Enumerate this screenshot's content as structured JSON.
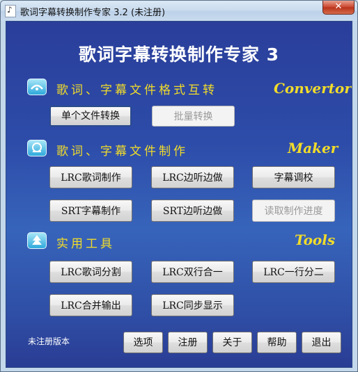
{
  "window": {
    "title": "歌词字幕转换制作专家 3.2 (未注册)",
    "close_label": "✕"
  },
  "app_title": "歌词字幕转换制作专家 3",
  "sections": {
    "convert": {
      "title": "歌词、字幕文件格式互转",
      "en": "Convertor",
      "buttons": {
        "single": "单个文件转换",
        "batch": "批量转换"
      }
    },
    "maker": {
      "title": "歌词、字幕文件制作",
      "en": "Maker",
      "buttons": {
        "lrc_make": "LRC歌词制作",
        "lrc_listen": "LRC边听边做",
        "sub_adjust": "字幕调校",
        "srt_make": "SRT字幕制作",
        "srt_listen": "SRT边听边做",
        "load_progress": "读取制作进度"
      }
    },
    "tools": {
      "title": "实用工具",
      "en": "Tools",
      "buttons": {
        "lrc_split": "LRC歌词分割",
        "lrc_merge_two": "LRC双行合一",
        "lrc_one_to_two": "LRC一行分二",
        "lrc_merge_out": "LRC合并输出",
        "lrc_sync": "LRC同步显示"
      }
    }
  },
  "footer": {
    "status": "未注册版本",
    "buttons": {
      "options": "选项",
      "register": "注册",
      "about": "关于",
      "help": "帮助",
      "exit": "退出"
    }
  }
}
